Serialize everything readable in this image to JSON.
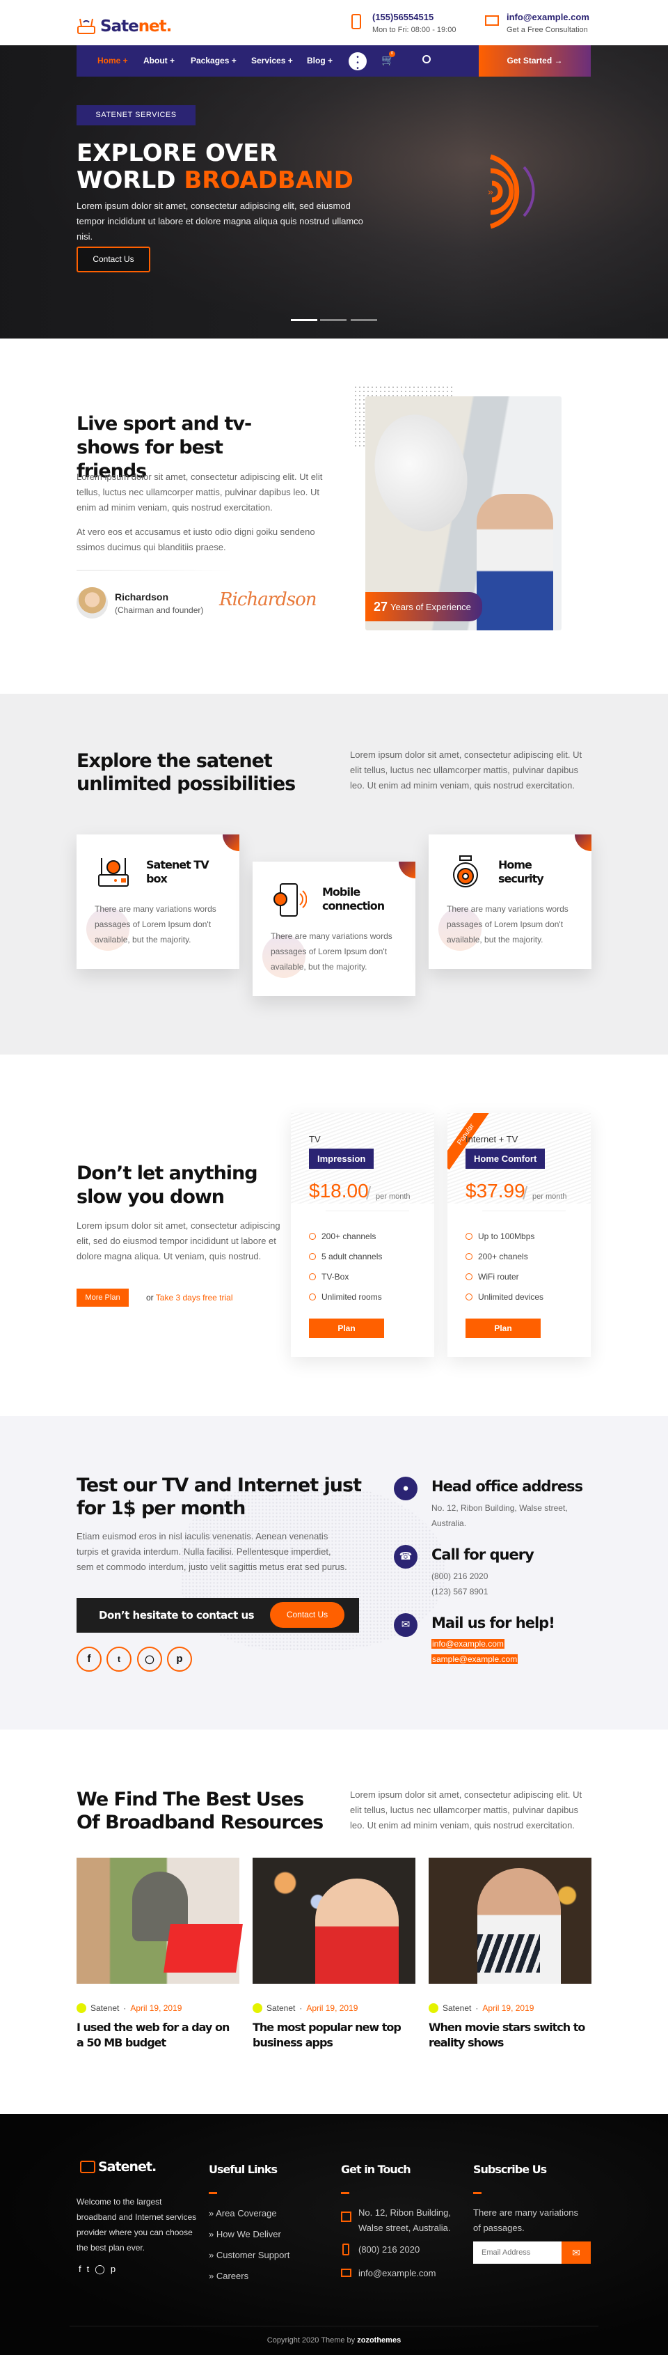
{
  "brand": {
    "name_a": "Sate",
    "name_b": "net.",
    "accent": "#ff6000",
    "primary": "#2b2473"
  },
  "topbar": {
    "phone": "(155)56554515",
    "hours": "Mon to Fri: 08:00 - 19:00",
    "email": "info@example.com",
    "consult": "Get a Free Consultation"
  },
  "nav": {
    "items": [
      "Home +",
      "About +",
      "Packages +",
      "Services +",
      "Blog +"
    ],
    "cart_count": "0",
    "cta": "Get Started"
  },
  "hero": {
    "badge": "SATENET SERVICES",
    "line1": "EXPLORE OVER",
    "line2a": "WORLD ",
    "line2b": "BROADBAND",
    "text": "Lorem ipsum dolor sit amet, consectetur adipiscing elit, sed eiusmod tempor incididunt ut labore et dolore magna aliqua quis nostrud ullamco nisi.",
    "button": "Contact Us",
    "slides": 3,
    "active_slide": 1
  },
  "about": {
    "title": "Live sport and tv-shows for best friends",
    "p1": "Lorem ipsum dolor sit amet, consectetur adipiscing elit. Ut elit tellus, luctus nec ullamcorper mattis, pulvinar dapibus leo. Ut enim ad minim veniam, quis nostrud exercitation.",
    "p2": "At vero eos et accusamus et iusto odio digni goiku sendeno ssimos ducimus qui blanditiis praese.",
    "name": "Richardson",
    "role": "(Chairman and founder)",
    "signature": "Richardson",
    "years": "27",
    "years_label": "Years of Experience"
  },
  "services": {
    "title": "Explore the satenet unlimited possibilities",
    "text": "Lorem ipsum dolor sit amet, consectetur adipiscing elit. Ut elit tellus, luctus nec ullamcorper mattis, pulvinar dapibus leo. Ut enim ad minim veniam, quis nostrud exercitation.",
    "cards": [
      {
        "title": "Satenet TV box",
        "icon": "router-icon",
        "text": "There are many variations words passages of Lorem Ipsum don't available, but the majority."
      },
      {
        "title": "Mobile connection",
        "icon": "mobile-icon",
        "text": "There are many variations words passages of Lorem Ipsum don't available, but the majority."
      },
      {
        "title": "Home security",
        "icon": "security-camera-icon",
        "text": "There are many variations words passages of Lorem Ipsum don't available, but the majority."
      }
    ]
  },
  "pricing": {
    "title": "Don’t let anything slow you down",
    "text": "Lorem ipsum dolor sit amet, consectetur adipiscing elit, sed do eiusmod tempor incididunt ut labore et dolore magna aliqua. Ut veniam, quis nostrud.",
    "more": "More Plan",
    "or": "or",
    "trial": "Take 3 days free trial",
    "plans": [
      {
        "category": "TV",
        "name": "Impression",
        "price": "$18.00",
        "per": "per month",
        "features": [
          "200+ channels",
          "5 adult channels",
          "TV-Box",
          "Unlimited rooms"
        ],
        "button": "Plan"
      },
      {
        "category": "Internet + TV",
        "name": "Home Comfort",
        "price": "$37.99",
        "per": "per month",
        "features": [
          "Up to 100Mbps",
          "200+ chanels",
          "WiFi router",
          "Unlimited devices"
        ],
        "button": "Plan",
        "ribbon": "Popular"
      }
    ]
  },
  "contact": {
    "title": "Test our TV and Internet just for 1$ per month",
    "text": "Etiam euismod eros in nisl iaculis venenatis. Aenean venenatis turpis et gravida interdum. Nulla facilisi. Pellentesque imperdiet, sem et commodo interdum, justo velit sagittis metus erat sed purus.",
    "banner": "Don’t hesitate to contact us",
    "button": "Contact Us",
    "office_title": "Head office address",
    "address1": "No. 12, Ribon Building, Walse street,",
    "address2": "Australia.",
    "call_title": "Call for query",
    "phone1": "(800) 216 2020",
    "phone2": "(123) 567 8901",
    "mail_title": "Mail us for help!",
    "email1": "info@example.com",
    "email2": "sample@example.com"
  },
  "blog": {
    "title": "We Find The Best Uses Of Broadband Resources",
    "text": "Lorem ipsum dolor sit amet, consectetur adipiscing elit. Ut elit tellus, luctus nec ullamcorper mattis, pulvinar dapibus leo. Ut enim ad minim veniam, quis nostrud exercitation.",
    "posts": [
      {
        "author": "Satenet",
        "date": "April 19, 2019",
        "title": "I used the web for a day on a 50 MB budget"
      },
      {
        "author": "Satenet",
        "date": "April 19, 2019",
        "title": "The most popular new top business apps"
      },
      {
        "author": "Satenet",
        "date": "April 19, 2019",
        "title": "When movie stars switch to reality shows"
      }
    ]
  },
  "footer": {
    "logo": "Satenet.",
    "about": "Welcome to the largest broadband and Internet services provider where you can choose the best plan ever.",
    "links_title": "Useful Links",
    "links": [
      "Area Coverage",
      "How We Deliver",
      "Customer Support",
      "Careers"
    ],
    "touch_title": "Get in Touch",
    "address": "No. 12, Ribon Building, Walse street, Australia.",
    "phone": "(800) 216 2020",
    "email": "info@example.com",
    "sub_title": "Subscribe Us",
    "sub_text": "There are many variations of passages.",
    "placeholder": "Email Address",
    "copy": "Copyright 2020 Theme by ",
    "copy_brand": "zozothemes"
  }
}
